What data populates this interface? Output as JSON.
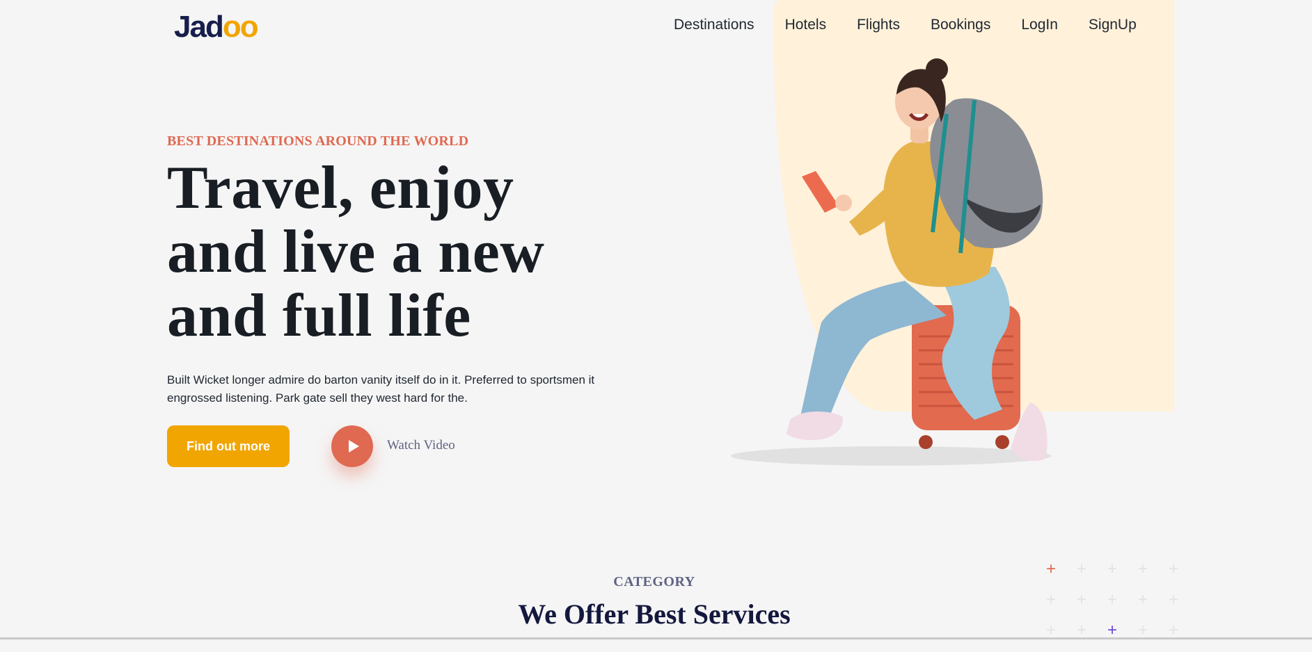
{
  "brand": {
    "logo_prefix": "Jad",
    "logo_accent": "oo",
    "accent_color": "#f1a501"
  },
  "nav": {
    "items": [
      "Destinations",
      "Hotels",
      "Flights",
      "Bookings",
      "LogIn",
      "SignUp"
    ]
  },
  "hero": {
    "eyebrow": "BEST DESTINATIONS AROUND THE WORLD",
    "headline_lines": [
      "Travel, enjoy",
      "and live a new",
      "and full life"
    ],
    "description": "Built Wicket longer admire do barton vanity itself do in it. Preferred to sportsmen it engrossed listening. Park gate sell they west hard for the.",
    "cta_label": "Find out more",
    "watch_label": "Watch Video",
    "image": "traveler-with-backpack-on-suitcase"
  },
  "section": {
    "eyebrow": "CATEGORY",
    "title": "We Offer Best Services"
  },
  "colors": {
    "orange": "#df6951",
    "yellow": "#f1a501",
    "peach": "#fff1da",
    "navy": "#181e4b"
  }
}
